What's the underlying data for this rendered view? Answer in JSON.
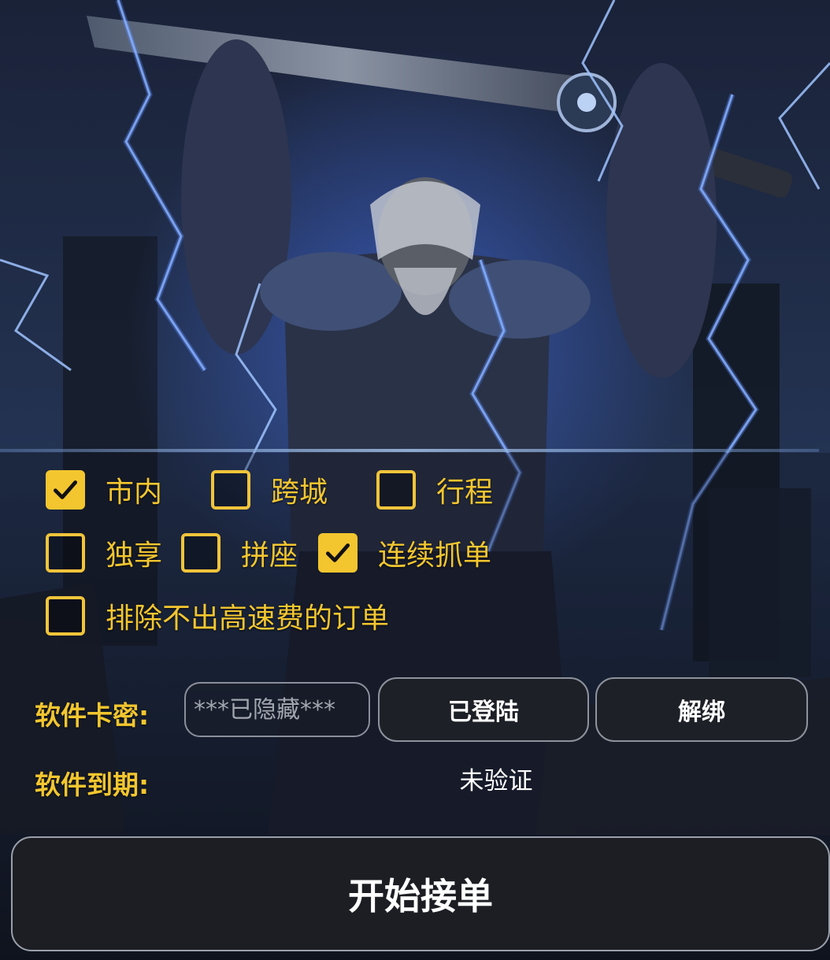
{
  "options": {
    "row1": [
      {
        "label": "市内",
        "checked": true
      },
      {
        "label": "跨城",
        "checked": false
      },
      {
        "label": "行程",
        "checked": false
      }
    ],
    "row2": [
      {
        "label": "独享",
        "checked": false
      },
      {
        "label": "拼座",
        "checked": false
      },
      {
        "label": "连续抓单",
        "checked": true
      }
    ],
    "row3": [
      {
        "label": "排除不出高速费的订单",
        "checked": false
      }
    ]
  },
  "license": {
    "key_label": "软件卡密:",
    "key_placeholder": "***已隐藏***",
    "login_button": "已登陆",
    "unbind_button": "解绑",
    "expire_label": "软件到期:",
    "expire_value": "未验证"
  },
  "start_button": "开始接单",
  "colors": {
    "accent": "#f3c62f",
    "button_bg": "#1d2027",
    "button_border": "#8d929c",
    "text_white": "#ffffff"
  },
  "icons": {
    "checkmark": "check-icon"
  }
}
